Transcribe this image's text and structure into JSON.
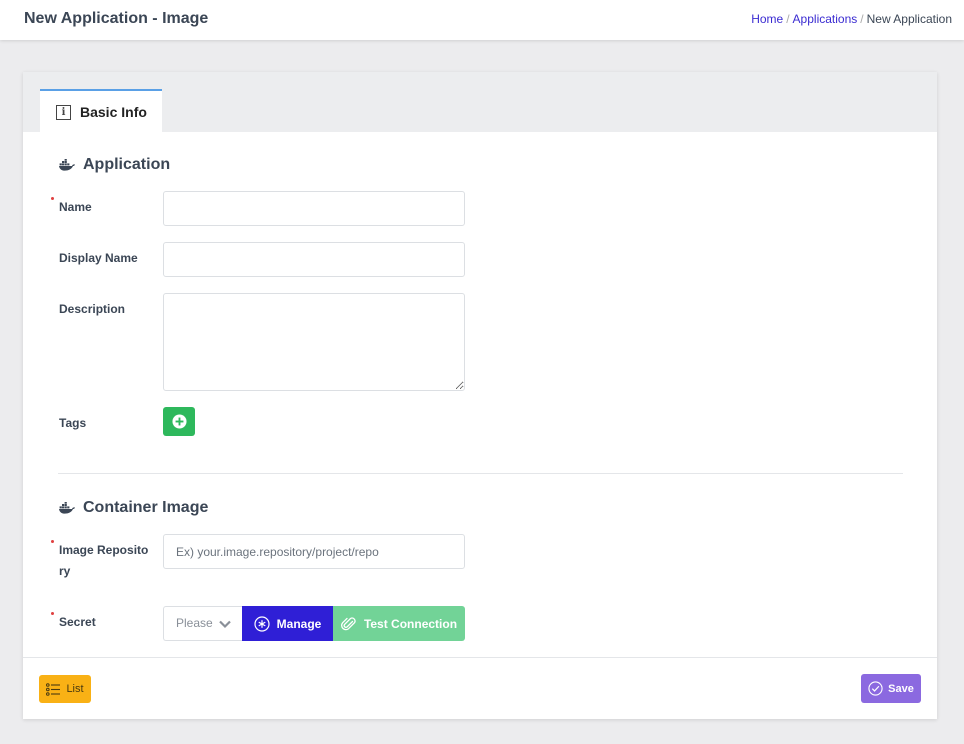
{
  "header": {
    "title": "New Application - Image",
    "breadcrumb": [
      {
        "label": "Home"
      },
      {
        "label": "Applications"
      },
      {
        "label": "New Application"
      }
    ]
  },
  "tabs": [
    {
      "label": "Basic Info",
      "icon": "info-icon",
      "active": true
    }
  ],
  "application_section": {
    "title": "Application",
    "icon": "docker-icon",
    "fields": {
      "name": {
        "label": "Name",
        "required": true,
        "value": "",
        "placeholder": ""
      },
      "display_name": {
        "label": "Display Name",
        "required": false,
        "value": "",
        "placeholder": ""
      },
      "description": {
        "label": "Description",
        "required": false,
        "value": "",
        "placeholder": ""
      },
      "tags": {
        "label": "Tags",
        "add_icon": "plus-circle-icon"
      }
    }
  },
  "container_section": {
    "title": "Container Image",
    "icon": "docker-icon",
    "fields": {
      "image_repository": {
        "label_line1": "Image Reposito",
        "label_line2": "ry",
        "required": true,
        "value": "",
        "placeholder": "Ex) your.image.repository/project/repo"
      },
      "secret": {
        "label": "Secret",
        "required": true,
        "select_text": "Please select"
      }
    },
    "buttons": {
      "manage": "Manage",
      "test_connection": "Test Connection"
    }
  },
  "footer": {
    "list_label": "List",
    "save_label": "Save"
  },
  "colors": {
    "primary": "#2f1fd6",
    "success": "#2eb85c",
    "success_light": "#72d397",
    "warning": "#f9b115",
    "save": "#8b69e0",
    "required": "#e04040",
    "tab_accent": "#5aa0e6"
  }
}
